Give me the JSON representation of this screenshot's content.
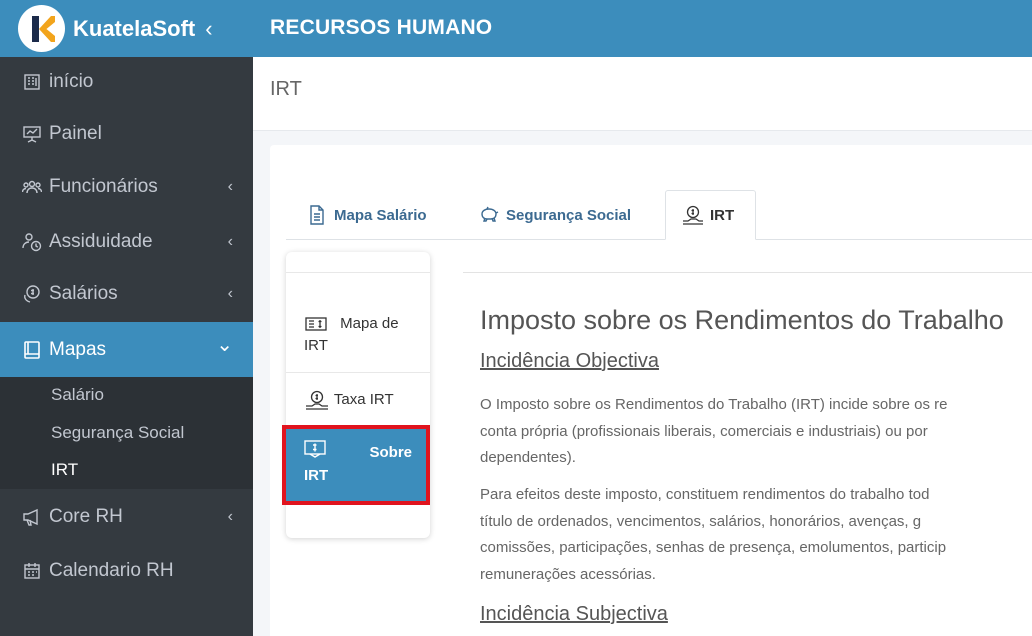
{
  "brand": {
    "name": "KuatelaSoft",
    "toggle": "‹",
    "logo_letter": "K"
  },
  "colors": {
    "primary": "#3c8dbc",
    "sidebar": "#343a40",
    "highlight": "#e0141e"
  },
  "sidebar": {
    "items": [
      {
        "label": "início",
        "icon": "building-icon"
      },
      {
        "label": "Painel",
        "icon": "presentation-icon"
      },
      {
        "label": "Funcionários",
        "icon": "users-icon",
        "chevron": "‹"
      },
      {
        "label": "Assiduidade",
        "icon": "user-clock-icon",
        "chevron": "‹"
      },
      {
        "label": "Salários",
        "icon": "coins-icon",
        "chevron": "‹"
      },
      {
        "label": "Mapas",
        "icon": "book-icon",
        "chevron": "⌄"
      },
      {
        "label": "Core RH",
        "icon": "megaphone-icon",
        "chevron": "‹"
      },
      {
        "label": "Calendario RH",
        "icon": "calendar-icon"
      }
    ],
    "submenu": [
      {
        "label": "Salário"
      },
      {
        "label": "Segurança Social"
      },
      {
        "label": "IRT"
      }
    ]
  },
  "header": {
    "title": "RECURSOS HUMANO"
  },
  "page": {
    "title": "IRT"
  },
  "tabs": [
    {
      "label": "Mapa Salário",
      "icon": "document-icon"
    },
    {
      "label": "Segurança Social",
      "icon": "piggy-bank-icon"
    },
    {
      "label": "IRT",
      "icon": "hand-coin-icon"
    }
  ],
  "vnav": {
    "item1": {
      "line1": "Mapa de",
      "line2": "IRT"
    },
    "item2": {
      "label": "Taxa IRT"
    },
    "item3": {
      "line1": "Sobre",
      "line2": "IRT"
    }
  },
  "content": {
    "heading": "Imposto sobre os Rendimentos do Trabalho",
    "sub1": "Incidência Objectiva",
    "p1": [
      "O Imposto sobre os Rendimentos do Trabalho (IRT) incide sobre os re",
      "conta própria (profissionais liberais, comerciais e industriais) ou por",
      "dependentes)."
    ],
    "p2": [
      "Para efeitos deste imposto, constituem rendimentos do trabalho tod",
      "título de ordenados, vencimentos, salários, honorários, avenças, g",
      "comissões, participações, senhas de presença, emolumentos, particip",
      "remunerações acessórias."
    ],
    "sub2": "Incidência Subjectiva"
  }
}
